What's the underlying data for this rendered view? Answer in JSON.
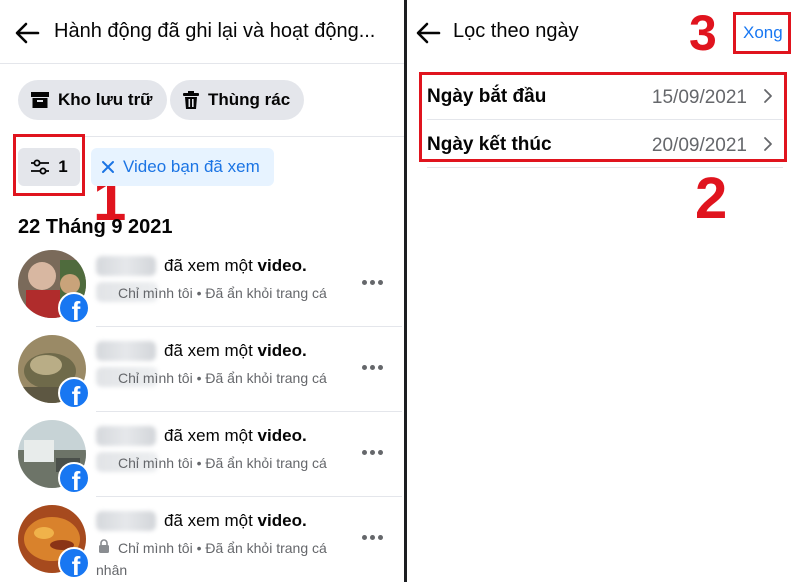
{
  "left_panel": {
    "title": "Hành động đã ghi lại và hoạt động...",
    "pills": {
      "archive": "Kho lưu trữ",
      "trash": "Thùng rác"
    },
    "filter_count": "1",
    "active_filter": "Video bạn đã xem",
    "date_heading": "22 Tháng 9 2021",
    "rows": [
      {
        "action": "đã xem một",
        "object": "video.",
        "privacy": "Chỉ mình tôi",
        "status": "Đã ẩn khỏi trang cá"
      },
      {
        "action": "đã xem một",
        "object": "video.",
        "privacy": "Chỉ mình tôi",
        "status": "Đã ẩn khỏi trang cá"
      },
      {
        "action": "đã xem một",
        "object": "video.",
        "privacy": "Chỉ mình tôi",
        "status": "Đã ẩn khỏi trang cá"
      },
      {
        "action": "đã xem một",
        "object": "video.",
        "privacy": "Chỉ mình tôi",
        "status": "Đã ẩn khỏi trang cá",
        "status_cont": "nhân"
      }
    ],
    "step_marker": "1"
  },
  "right_panel": {
    "title": "Lọc theo ngày",
    "done_label": "Xong",
    "start_label": "Ngày bắt đầu",
    "start_value": "15/09/2021",
    "end_label": "Ngày kết thúc",
    "end_value": "20/09/2021",
    "step_marker_2": "2",
    "step_marker_3": "3"
  },
  "colors": {
    "accent": "#1877f2",
    "annotation_red": "#e0141e",
    "chip_bg": "#e4e6eb",
    "muted_text": "#65676b"
  },
  "icons": [
    "back-arrow-icon",
    "archive-box-icon",
    "trash-icon",
    "filter-sliders-icon",
    "close-x-icon",
    "facebook-icon",
    "more-dots-icon",
    "lock-icon",
    "chevron-right-icon"
  ]
}
